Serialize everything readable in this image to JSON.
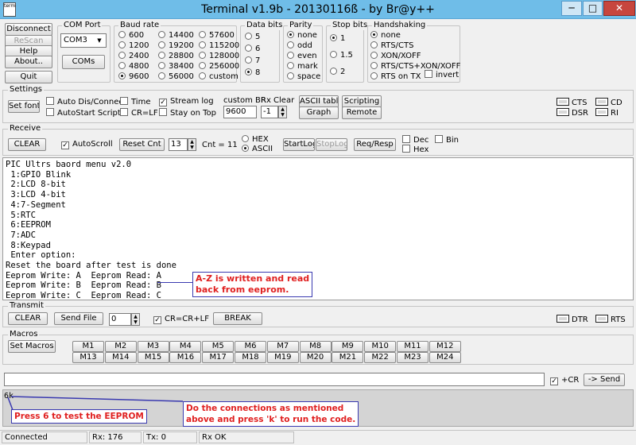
{
  "window": {
    "title": "Terminal v1.9b - 20130116ß - by Br@y++",
    "icon_text": "term",
    "minimize": "─",
    "maximize": "□",
    "close": "✕"
  },
  "top_buttons": {
    "disconnect": "Disconnect",
    "rescan": "ReScan",
    "help": "Help",
    "about": "About..",
    "quit": "Quit"
  },
  "com_port": {
    "label": "COM Port",
    "value": "COM3",
    "coms_button": "COMs"
  },
  "baud_rate": {
    "label": "Baud rate",
    "options": [
      "600",
      "1200",
      "2400",
      "4800",
      "9600",
      "14400",
      "19200",
      "28800",
      "38400",
      "56000",
      "57600",
      "115200",
      "128000",
      "256000",
      "custom"
    ],
    "selected": "9600"
  },
  "data_bits": {
    "label": "Data bits",
    "options": [
      "5",
      "6",
      "7",
      "8"
    ],
    "selected": "8"
  },
  "parity": {
    "label": "Parity",
    "options": [
      "none",
      "odd",
      "even",
      "mark",
      "space"
    ],
    "selected": "none"
  },
  "stop_bits": {
    "label": "Stop bits",
    "options": [
      "1",
      "1.5",
      "2"
    ],
    "selected": "1"
  },
  "handshaking": {
    "label": "Handshaking",
    "options": [
      "none",
      "RTS/CTS",
      "XON/XOFF",
      "RTS/CTS+XON/XOFF",
      "RTS on TX"
    ],
    "selected": "none",
    "invert": "invert"
  },
  "settings": {
    "label": "Settings",
    "set_font": "Set font",
    "auto_dis_connect": "Auto Dis/Connect",
    "autostart_script": "AutoStart Script",
    "time": "Time",
    "cr_lf": "CR=LF",
    "stream_log": "Stream log",
    "stay_on_top": "Stay on Top",
    "custom_br_label": "custom BR",
    "custom_br_value": "9600",
    "rx_clear_label": "Rx Clear",
    "rx_clear_value": "-1",
    "ascii_table": "ASCII table",
    "graph": "Graph",
    "scripting": "Scripting",
    "remote": "Remote",
    "leds": [
      "CTS",
      "CD",
      "DSR",
      "RI"
    ]
  },
  "receive": {
    "label": "Receive",
    "clear": "CLEAR",
    "autoscroll": "AutoScroll",
    "reset_cnt": "Reset Cnt",
    "cnt_value": "13",
    "cnt_display": "Cnt =  11",
    "hex": "HEX",
    "ascii": "ASCII",
    "startlog": "StartLog",
    "stoplog": "StopLog",
    "req_resp": "Req/Resp",
    "dec": "Dec",
    "hex2": "Hex",
    "bin": "Bin"
  },
  "terminal_lines": [
    "PIC Ultrs baord menu v2.0",
    " 1:GPIO Blink",
    " 2:LCD 8-bit",
    " 3:LCD 4-bit",
    " 4:7-Segment",
    " 5:RTC",
    " 6:EEPROM",
    " 7:ADC",
    " 8:Keypad",
    " Enter option:",
    "Reset the board after test is done",
    "Eeprom Write: A  Eeprom Read: A",
    "Eeprom Write: B  Eeprom Read: B",
    "Eeprom Write: C  Eeprom Read: C"
  ],
  "annotations": {
    "az": [
      "A-Z is written and read",
      "back from eeprom."
    ],
    "press6": "Press 6 to test the EEPROM",
    "connections": [
      "Do the connections as mentioned",
      "above and press 'k' to run the code."
    ]
  },
  "transmit": {
    "label": "Transmit",
    "clear": "CLEAR",
    "send_file": "Send File",
    "value": "0",
    "cr_crlf": "CR=CR+LF",
    "break": "BREAK",
    "leds": [
      "DTR",
      "RTS"
    ]
  },
  "macros": {
    "label": "Macros",
    "set_macros": "Set Macros",
    "row1": [
      "M1",
      "M2",
      "M3",
      "M4",
      "M5",
      "M6",
      "M7",
      "M8",
      "M9",
      "M10",
      "M11",
      "M12"
    ],
    "row2": [
      "M13",
      "M14",
      "M15",
      "M16",
      "M17",
      "M18",
      "M19",
      "M20",
      "M21",
      "M22",
      "M23",
      "M24"
    ]
  },
  "send": {
    "input_value": "",
    "plus_cr": "+CR",
    "send_button": "-> Send"
  },
  "send_history": "6k",
  "status": {
    "connected": "Connected",
    "rx": "Rx: 176",
    "tx": "Tx: 0",
    "rx_ok": "Rx OK"
  }
}
